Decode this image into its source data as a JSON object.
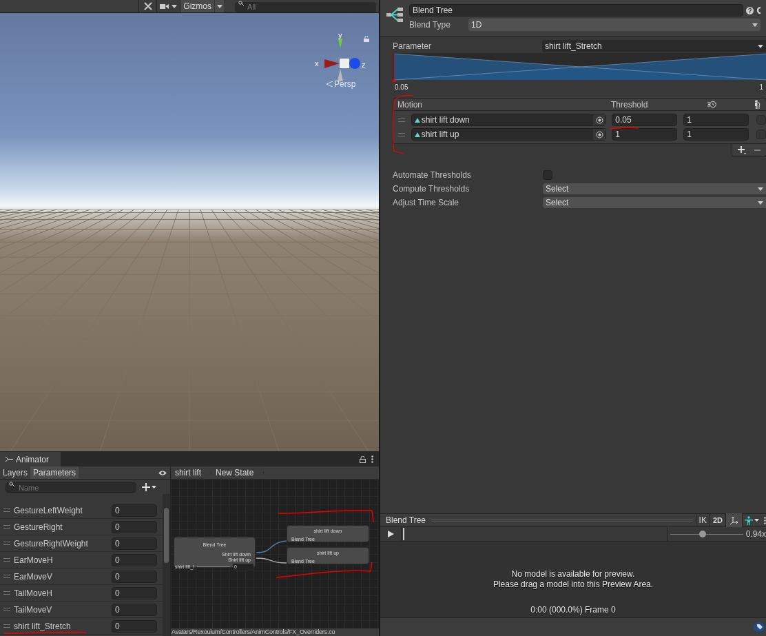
{
  "scene_toolbar": {
    "gizmos_label": "Gizmos",
    "search": {
      "placeholder": "All"
    }
  },
  "scene_view": {
    "gizmo": {
      "x_label": "x",
      "y_label": "y",
      "z_label": "z"
    },
    "projection": "Persp"
  },
  "animator": {
    "title": "Animator",
    "tabs": [
      {
        "label": "Layers",
        "selected": false
      },
      {
        "label": "Parameters",
        "selected": true
      }
    ],
    "search": {
      "placeholder": "Name"
    },
    "parameters": [
      {
        "name": "GestureLeftWeight",
        "value": "0"
      },
      {
        "name": "GestureRight",
        "value": "0"
      },
      {
        "name": "GestureRightWeight",
        "value": "0"
      },
      {
        "name": "EarMoveH",
        "value": "0"
      },
      {
        "name": "EarMoveV",
        "value": "0"
      },
      {
        "name": "TailMoveH",
        "value": "0"
      },
      {
        "name": "TailMoveV",
        "value": "0"
      },
      {
        "name": "shirt lift_Stretch",
        "value": "0"
      }
    ],
    "breadcrumbs": [
      "shirt lift",
      "New State"
    ],
    "graph": {
      "blend_node": {
        "title": "Blend Tree",
        "outputs": [
          "Shirt lift down",
          "Shirt lift up"
        ],
        "parameter": "shirt lift_!",
        "value": "0"
      },
      "motion_nodes": [
        {
          "title": "shirt lift down",
          "subtitle": "Blend Tree"
        },
        {
          "title": "shirt lift up",
          "subtitle": "Blend Tree"
        }
      ]
    },
    "asset_path": "Avatars/Rexouium/Controllers/AnimControls/FX_Overriders.co"
  },
  "inspector": {
    "name": "Blend Tree",
    "blend_type_label": "Blend Type",
    "blend_type": "1D",
    "parameter_label": "Parameter",
    "parameter": "shirt lift_Stretch",
    "range_min": "0.05",
    "range_max": "1",
    "columns": [
      "Motion",
      "Threshold"
    ],
    "motions": [
      {
        "name": "shirt lift down",
        "threshold": "0.05",
        "speed": "1",
        "mirror": false
      },
      {
        "name": "shirt lift up",
        "threshold": "1",
        "speed": "1",
        "mirror": false
      }
    ],
    "automate_thresholds": {
      "label": "Automate Thresholds",
      "checked": false
    },
    "compute_thresholds": {
      "label": "Compute Thresholds",
      "value": "Select"
    },
    "adjust_time_scale": {
      "label": "Adjust Time Scale",
      "value": "Select"
    }
  },
  "preview": {
    "title": "Blend Tree",
    "ik_label": "IK",
    "mode_label": "2D",
    "speed": {
      "level": 0.45,
      "reading": "0.94x"
    },
    "messages": [
      "No model is available for preview.",
      "Please drag a model into this Preview Area."
    ],
    "time": "0:00 (000.0%) Frame 0"
  }
}
